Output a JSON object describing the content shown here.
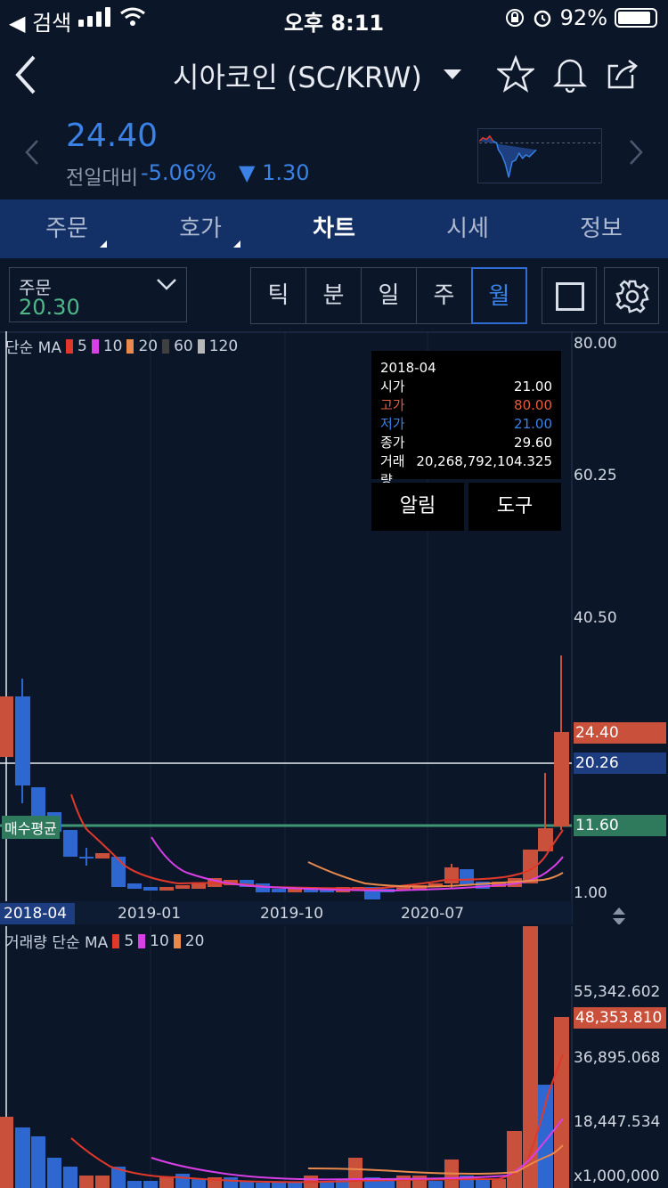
{
  "status_bar": {
    "back_label": "◀ 검색",
    "time": "오후 8:11",
    "battery": "92%"
  },
  "header": {
    "title": "시아코인 (SC/KRW)"
  },
  "price": {
    "current": "24.40",
    "change_label": "전일대비",
    "change_rate": "-5.06%",
    "change_amount": "▼ 1.30"
  },
  "tabs": [
    {
      "label": "주문"
    },
    {
      "label": "호가"
    },
    {
      "label": "차트"
    },
    {
      "label": "시세"
    },
    {
      "label": "정보"
    }
  ],
  "toolbar": {
    "order_label": "주문",
    "order_value": "20.30",
    "periods": [
      "틱",
      "분",
      "일",
      "주",
      "월"
    ],
    "active_period": "월"
  },
  "chart": {
    "ma_legend": {
      "title": "단순 MA",
      "items": [
        {
          "label": "5",
          "color": "#e0392b"
        },
        {
          "label": "10",
          "color": "#d93fe6"
        },
        {
          "label": "20",
          "color": "#e98a4c"
        },
        {
          "label": "60",
          "color": "#404040"
        },
        {
          "label": "120",
          "color": "#b7b7b7"
        }
      ]
    },
    "y_axis": [
      "80.00",
      "60.25",
      "40.50",
      "1.00"
    ],
    "tags": {
      "current": "24.40",
      "line": "20.26",
      "avg": "11.60",
      "avg_label": "매수평균"
    },
    "x_axis": [
      "2018-04",
      "2019-01",
      "2019-10",
      "2020-07"
    ],
    "tooltip": {
      "date": "2018-04",
      "rows": [
        {
          "label": "시가",
          "value": "21.00",
          "color": "#ffffff"
        },
        {
          "label": "고가",
          "value": "80.00",
          "color": "#e35d3c"
        },
        {
          "label": "저가",
          "value": "21.00",
          "color": "#3a82e6"
        },
        {
          "label": "종가",
          "value": "29.60",
          "color": "#ffffff"
        },
        {
          "label": "거래량",
          "value": "20,268,792,104.325",
          "color": "#ffffff"
        }
      ],
      "buttons": [
        "알림",
        "도구"
      ]
    }
  },
  "volume": {
    "legend": {
      "title": "거래량 단순 MA",
      "items": [
        {
          "label": "5",
          "color": "#e0392b"
        },
        {
          "label": "10",
          "color": "#d93fe6"
        },
        {
          "label": "20",
          "color": "#e98a4c"
        }
      ]
    },
    "y_axis": [
      "55,342.602",
      "36,895.068",
      "18,447.534",
      "x1,000,000"
    ],
    "current_tag": "48,353.810"
  },
  "colors": {
    "up": "#c9503a",
    "down": "#2f67d0",
    "accent": "#3a82e6",
    "tabs_bg": "#133067",
    "avg_line": "#2f7a5c"
  }
}
